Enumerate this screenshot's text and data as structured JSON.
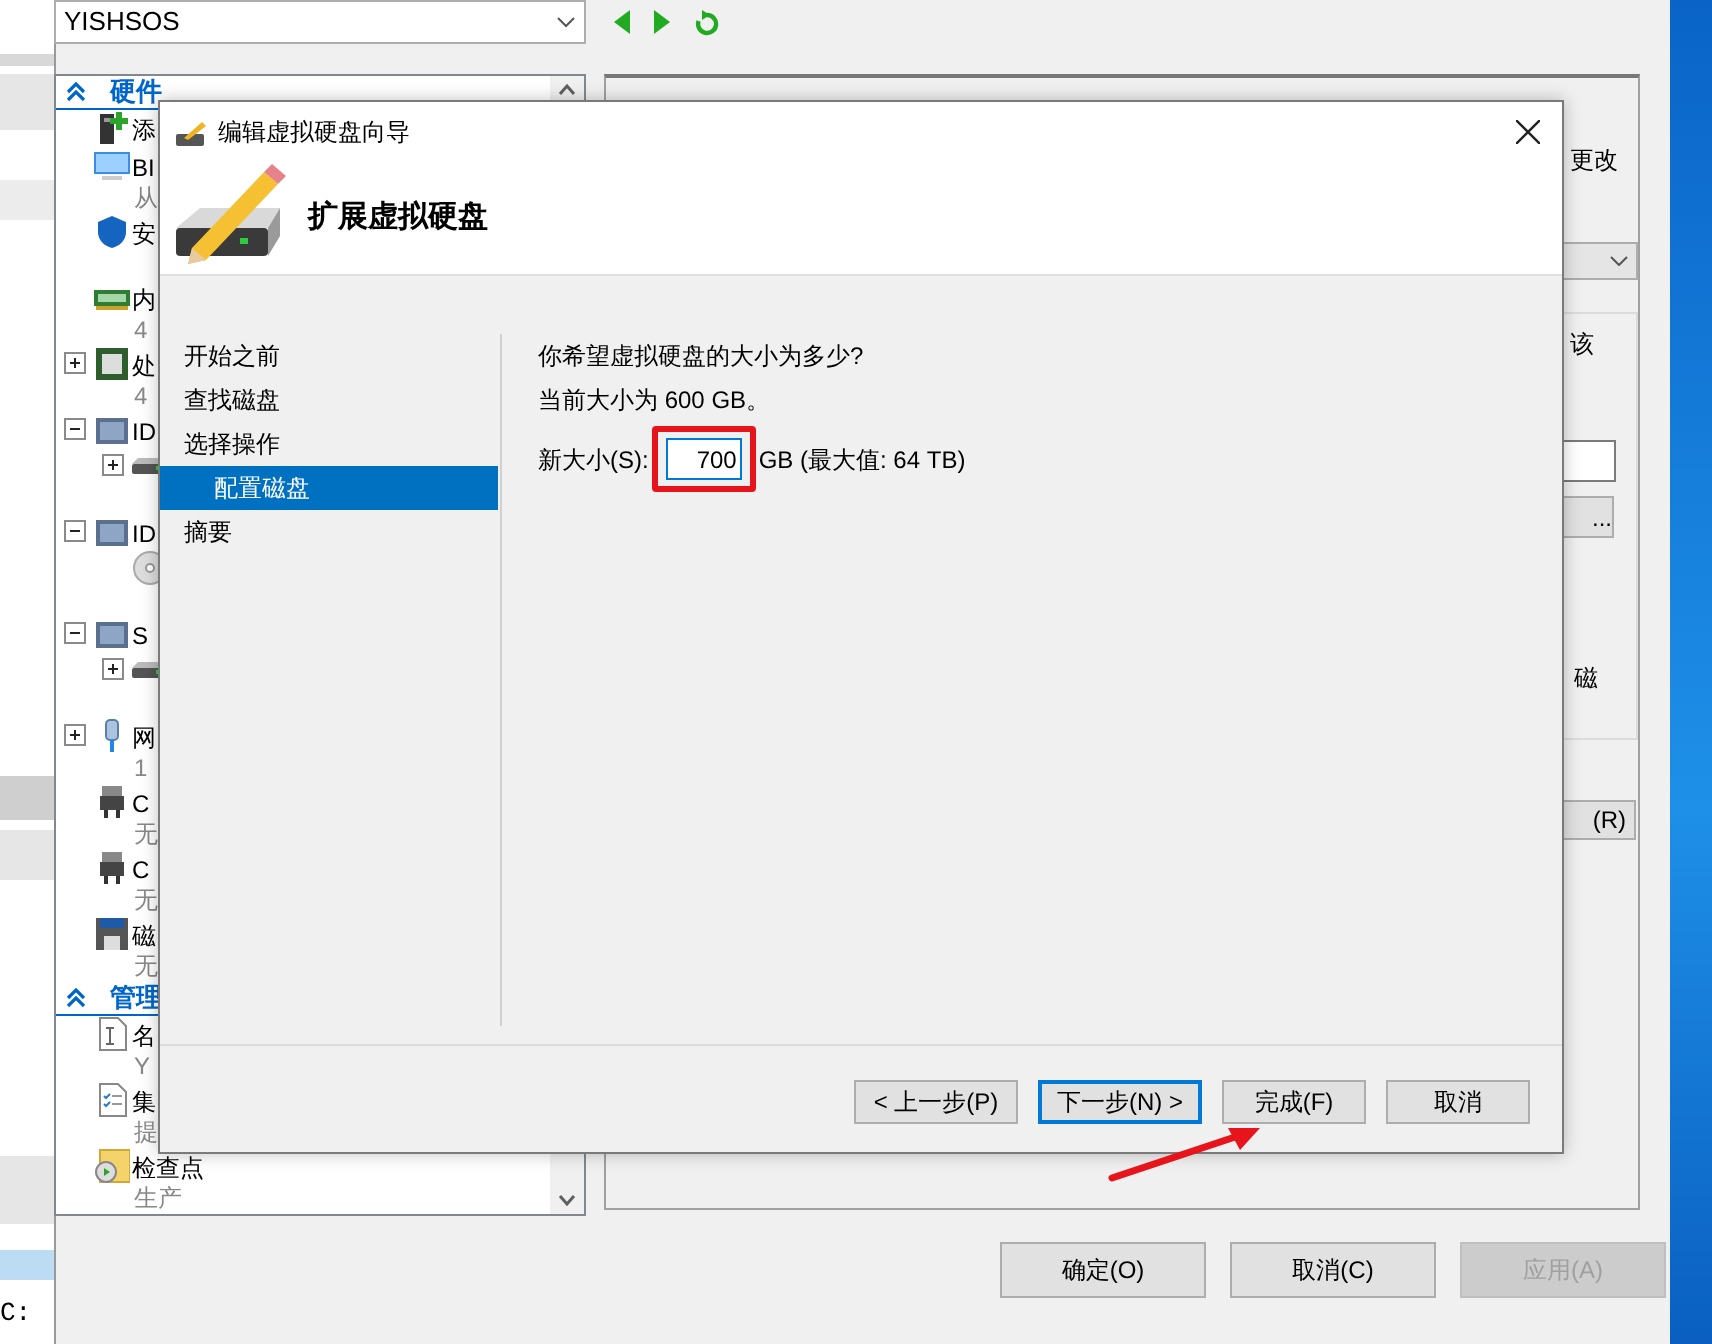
{
  "side_window": {
    "text": "C:"
  },
  "settings_window": {
    "host_selector": {
      "value": "YISHSOS"
    },
    "tree": [
      {
        "kind": "section",
        "label": "硬件",
        "expanded": true,
        "children": [
          {
            "kind": "device",
            "title": "添"
          },
          {
            "kind": "device",
            "title": "BI",
            "subtitle": "从"
          },
          {
            "kind": "device",
            "title": "安"
          },
          {
            "kind": "device",
            "title": "内",
            "subtitle": "4"
          },
          {
            "kind": "device",
            "title": "处",
            "subtitle": "4",
            "expanded": false
          },
          {
            "kind": "device",
            "title": "ID",
            "expanded": true,
            "children": [
              {
                "kind": "device",
                "expanded": false
              }
            ]
          },
          {
            "kind": "device",
            "title": "ID",
            "expanded": true,
            "children": [
              {
                "kind": "device"
              }
            ]
          },
          {
            "kind": "device",
            "title": "S",
            "expanded": true,
            "children": [
              {
                "kind": "device",
                "expanded": false
              }
            ]
          },
          {
            "kind": "device",
            "title": "网",
            "subtitle": "1",
            "expanded": false
          },
          {
            "kind": "device",
            "title": "C",
            "subtitle": "无"
          },
          {
            "kind": "device",
            "title": "C",
            "subtitle": "无"
          },
          {
            "kind": "device",
            "title": "磁",
            "subtitle": "无"
          }
        ]
      },
      {
        "kind": "section",
        "label": "管理",
        "expanded": true,
        "children": [
          {
            "kind": "device",
            "title": "名",
            "subtitle": "Y"
          },
          {
            "kind": "device",
            "title": "集",
            "subtitle": "提"
          },
          {
            "kind": "device",
            "title": "检查点",
            "subtitle": "生产"
          }
        ]
      }
    ],
    "right_fragments": {
      "text_1": "更改",
      "text_2": "该",
      "button_1": "...",
      "text_3": "磁",
      "button_2": "(R)"
    },
    "buttons": [
      {
        "label": "确定(O)",
        "disabled": false
      },
      {
        "label": "取消(C)",
        "disabled": false
      },
      {
        "label": "应用(A)",
        "disabled": true
      }
    ]
  },
  "dialog": {
    "title": "编辑虚拟硬盘向导",
    "heading": "扩展虚拟硬盘",
    "steps": [
      {
        "label": "开始之前",
        "selected": false
      },
      {
        "label": "查找磁盘",
        "selected": false
      },
      {
        "label": "选择操作",
        "selected": false,
        "children": [
          {
            "label": "配置磁盘",
            "selected": true
          }
        ]
      },
      {
        "label": "摘要",
        "selected": false
      }
    ],
    "question": "你希望虚拟硬盘的大小为多少?",
    "current_size": "当前大小为 600 GB。",
    "new_size_label": "新大小(S):",
    "new_size_value": "700",
    "new_size_hint": "GB (最大值: 64 TB)",
    "buttons": [
      {
        "label": "< 上一步(P)",
        "focused": false
      },
      {
        "label": "下一步(N) >",
        "focused": true
      },
      {
        "label": "完成(F)",
        "focused": false
      },
      {
        "label": "取消",
        "focused": false
      }
    ]
  }
}
